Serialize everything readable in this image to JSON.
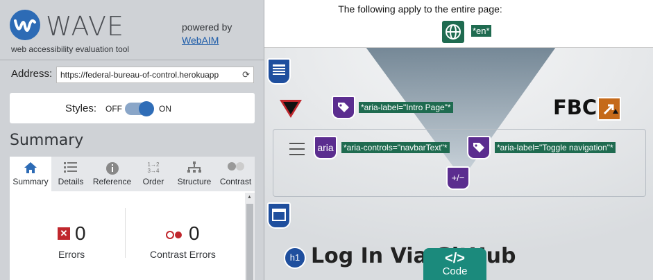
{
  "sidebar": {
    "app_name": "WAVE",
    "tagline": "web accessibility evaluation tool",
    "powered_by": "powered by",
    "powered_link": "WebAIM",
    "address_label": "Address:",
    "address_value": "https://federal-bureau-of-control.herokuapp",
    "styles_label": "Styles:",
    "styles_off": "OFF",
    "styles_on": "ON",
    "summary_title": "Summary",
    "tabs": [
      {
        "label": "Summary"
      },
      {
        "label": "Details"
      },
      {
        "label": "Reference"
      },
      {
        "label": "Order"
      },
      {
        "label": "Structure"
      },
      {
        "label": "Contrast"
      }
    ],
    "errors": {
      "count": "0",
      "label": "Errors"
    },
    "contrast_errors": {
      "count": "0",
      "label": "Contrast Errors"
    }
  },
  "page": {
    "apply_text": "The following apply to the entire page:",
    "lang_label": "*en*",
    "aria_label_intro": "*aria-label=\"Intro Page\"*",
    "aria_controls": "*aria-controls=\"navbarText\"*",
    "aria_label_toggle": "*aria-label=\"Toggle navigation\"*",
    "aria_badge": "aria",
    "fbc_text": "FBC",
    "heading_text": "Log In Via GitHub",
    "h1_badge": "h1",
    "expand_badge": "+/−",
    "code_button": {
      "symbol": "</>",
      "label": "Code"
    }
  },
  "colors": {
    "wave_green": "#1f6b50",
    "aria_purple": "#5b2d8f",
    "structure_blue": "#1f4f9e",
    "error_red": "#c0272d",
    "code_teal": "#1b8a7c"
  }
}
